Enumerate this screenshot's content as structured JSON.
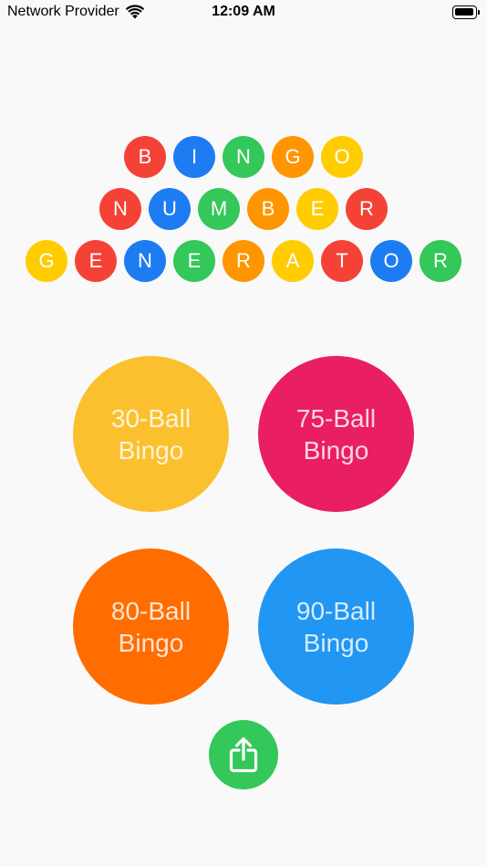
{
  "status_bar": {
    "carrier": "Network Provider",
    "time": "12:09 AM"
  },
  "title": {
    "rows": [
      [
        {
          "letter": "B",
          "color": "#f44336"
        },
        {
          "letter": "I",
          "color": "#1e7cf2"
        },
        {
          "letter": "N",
          "color": "#34c759"
        },
        {
          "letter": "G",
          "color": "#ff9500"
        },
        {
          "letter": "O",
          "color": "#ffcc00"
        }
      ],
      [
        {
          "letter": "N",
          "color": "#f44336"
        },
        {
          "letter": "U",
          "color": "#1e7cf2"
        },
        {
          "letter": "M",
          "color": "#34c759"
        },
        {
          "letter": "B",
          "color": "#ff9500"
        },
        {
          "letter": "E",
          "color": "#ffcc00"
        },
        {
          "letter": "R",
          "color": "#f44336"
        }
      ],
      [
        {
          "letter": "G",
          "color": "#ffcc00"
        },
        {
          "letter": "E",
          "color": "#f44336"
        },
        {
          "letter": "N",
          "color": "#1e7cf2"
        },
        {
          "letter": "E",
          "color": "#34c759"
        },
        {
          "letter": "R",
          "color": "#ff9500"
        },
        {
          "letter": "A",
          "color": "#ffcc00"
        },
        {
          "letter": "T",
          "color": "#f44336"
        },
        {
          "letter": "O",
          "color": "#1e7cf2"
        },
        {
          "letter": "R",
          "color": "#34c759"
        }
      ]
    ]
  },
  "games": {
    "ball30": {
      "line1": "30-Ball",
      "line2": "Bingo",
      "color": "#fbc02d"
    },
    "ball75": {
      "line1": "75-Ball",
      "line2": "Bingo",
      "color": "#e91e63"
    },
    "ball80": {
      "line1": "80-Ball",
      "line2": "Bingo",
      "color": "#ff6d00"
    },
    "ball90": {
      "line1": "90-Ball",
      "line2": "Bingo",
      "color": "#2196f3"
    }
  },
  "share": {
    "icon": "share-icon",
    "color": "#34c759"
  }
}
